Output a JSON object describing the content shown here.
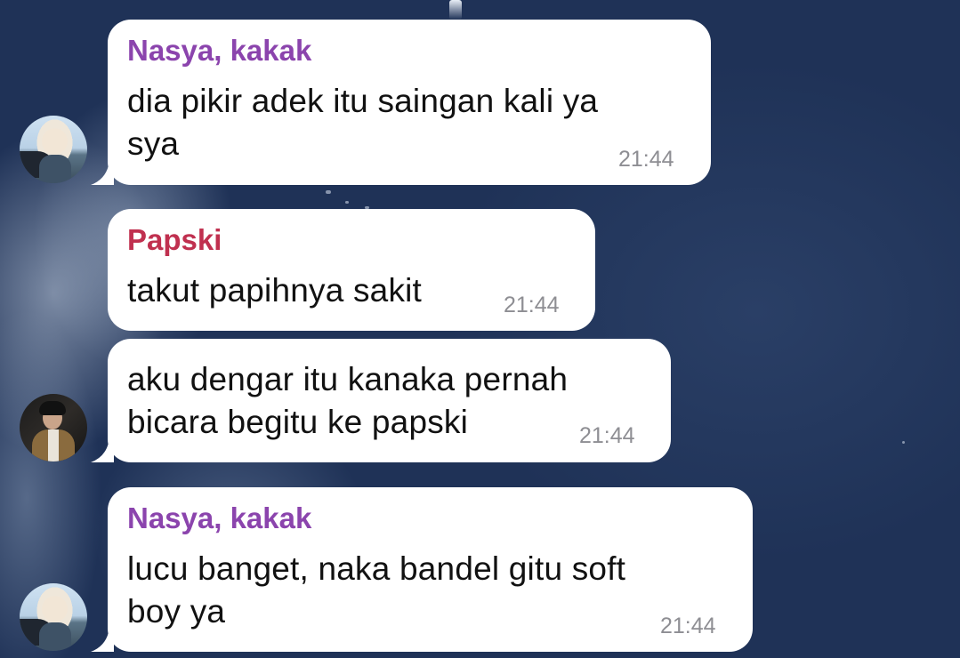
{
  "colors": {
    "sender_nasya": "#8b44ad",
    "sender_papski": "#c0304f",
    "timestamp": "#8e8e93",
    "bubble": "#ffffff"
  },
  "messages": [
    {
      "sender": "Nasya, kakak",
      "lines": [
        "dia pikir adek itu saingan kali ya",
        "sya"
      ],
      "time": "21:44",
      "avatar": "avatar-nasya"
    },
    {
      "sender": "Papski",
      "lines": [
        "takut papihnya sakit"
      ],
      "time": "21:44"
    },
    {
      "sender": "",
      "lines": [
        "aku dengar itu kanaka pernah",
        "bicara begitu ke papski"
      ],
      "time": "21:44",
      "avatar": "avatar-papski"
    },
    {
      "sender": "Nasya, kakak",
      "lines": [
        "lucu banget, naka bandel gitu soft",
        "boy ya"
      ],
      "time": "21:44",
      "avatar": "avatar-nasya"
    }
  ]
}
